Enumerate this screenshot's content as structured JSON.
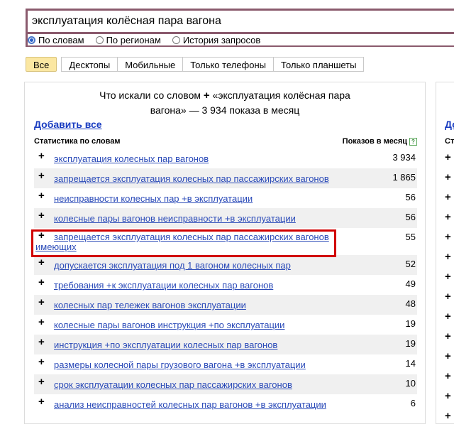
{
  "search": {
    "query": "эксплуатация колёсная пара вагона",
    "options": [
      {
        "label": "По словам",
        "checked": true
      },
      {
        "label": "По регионам",
        "checked": false
      },
      {
        "label": "История запросов",
        "checked": false
      }
    ]
  },
  "tabs": [
    {
      "label": "Все",
      "active": true
    },
    {
      "label": "Десктопы",
      "active": false
    },
    {
      "label": "Мобильные",
      "active": false
    },
    {
      "label": "Только телефоны",
      "active": false
    },
    {
      "label": "Только планшеты",
      "active": false
    }
  ],
  "panel": {
    "headline_prefix": "Что искали со словом",
    "headline_plus": "+",
    "headline_rest": "«эксплуатация колёсная пара",
    "headline_line2": "вагона» — 3 934 показа в месяц",
    "add_all": "Добавить все",
    "col_words": "Статистика по словам",
    "col_shows": "Показов в месяц",
    "help": "?",
    "rows": [
      {
        "text": "эксплуатация колесных пар вагонов",
        "count": "3 934"
      },
      {
        "text": "запрещается эксплуатация колесных пар пассажирских вагонов",
        "count": "1 865"
      },
      {
        "text": "неисправности колесных пар +в эксплуатации",
        "count": "56"
      },
      {
        "text": "колесные пары вагонов неисправности +в эксплуатации",
        "count": "56"
      },
      {
        "text": "запрещается эксплуатация колесных пар пассажирских вагонов имеющих",
        "count": "55"
      },
      {
        "text": "допускается эксплуатация под 1 вагоном колесных пар",
        "count": "52"
      },
      {
        "text": "требования +к эксплуатации колесных пар вагонов",
        "count": "49"
      },
      {
        "text": "колесных пар тележек вагонов эксплуатации",
        "count": "48"
      },
      {
        "text": "колесные пары вагонов инструкция +по эксплуатации",
        "count": "19"
      },
      {
        "text": "инструкция +по эксплуатации колесных пар вагонов",
        "count": "19"
      },
      {
        "text": "размеры колесной пары грузового вагона +в эксплуатации",
        "count": "14"
      },
      {
        "text": "срок эксплуатации колесных пар пассажирских вагонов",
        "count": "10"
      },
      {
        "text": "анализ неисправностей колесных пар вагонов +в эксплуатации",
        "count": "6"
      }
    ]
  },
  "right_panel": {
    "link": "До",
    "head": "Стати"
  },
  "colors": {
    "search_border": "#8a5a6d",
    "link": "#2a4ab8",
    "active_tab": "#fbe7a2",
    "highlight": "#d10000"
  }
}
